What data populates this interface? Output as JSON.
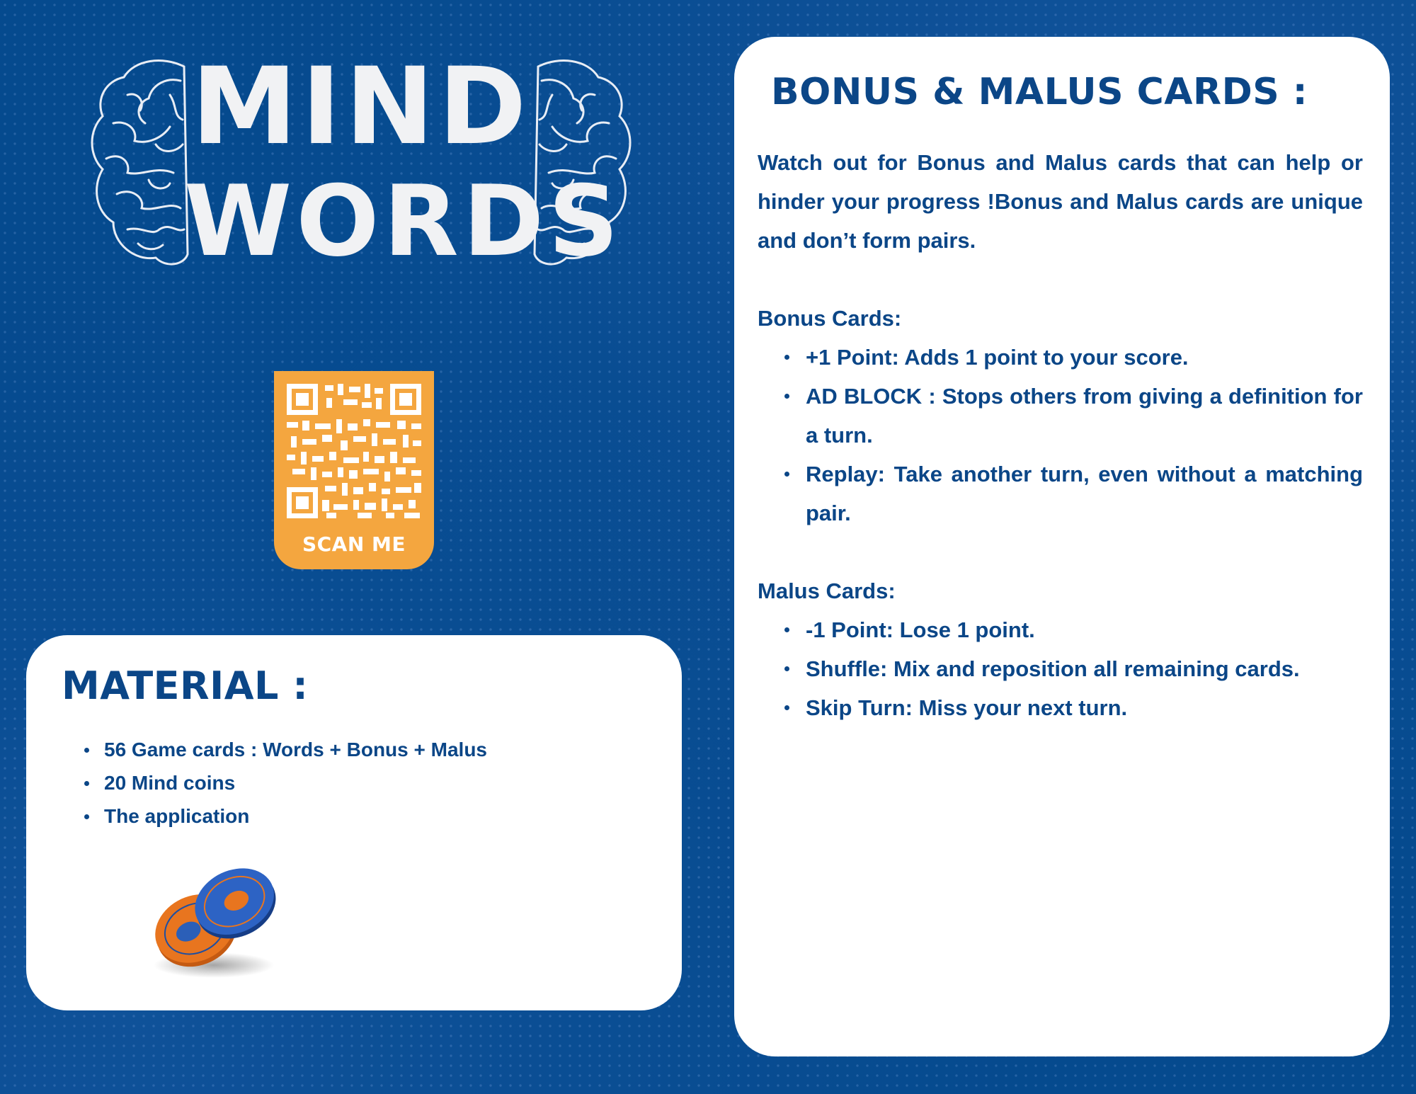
{
  "logo": {
    "line1": "MIND",
    "line2": "WORDS"
  },
  "qr": {
    "caption": "SCAN ME"
  },
  "material": {
    "heading": "MATERIAL :",
    "items": [
      "56 Game cards : Words + Bonus + Malus",
      "20 Mind coins",
      "The application"
    ]
  },
  "bonus_malus": {
    "heading": "BONUS & MALUS CARDS :",
    "intro": "Watch out for Bonus and Malus cards that can help or hinder your progress !Bonus and Malus cards are unique and don’t form pairs.",
    "bonus_title": "Bonus Cards:",
    "bonus_items": [
      "+1 Point: Adds 1 point to your score.",
      "AD BLOCK : Stops others from giving a definition for a turn.",
      "Replay: Take another turn, even without a matching pair."
    ],
    "malus_title": "Malus Cards:",
    "malus_items": [
      "-1 Point: Lose 1 point.",
      "Shuffle: Mix and reposition all remaining cards.",
      "Skip Turn: Miss your next turn."
    ]
  },
  "colors": {
    "background": "#054a8e",
    "text_blue": "#0b4687",
    "badge_orange": "#f4a63f",
    "panel_white": "#ffffff"
  }
}
